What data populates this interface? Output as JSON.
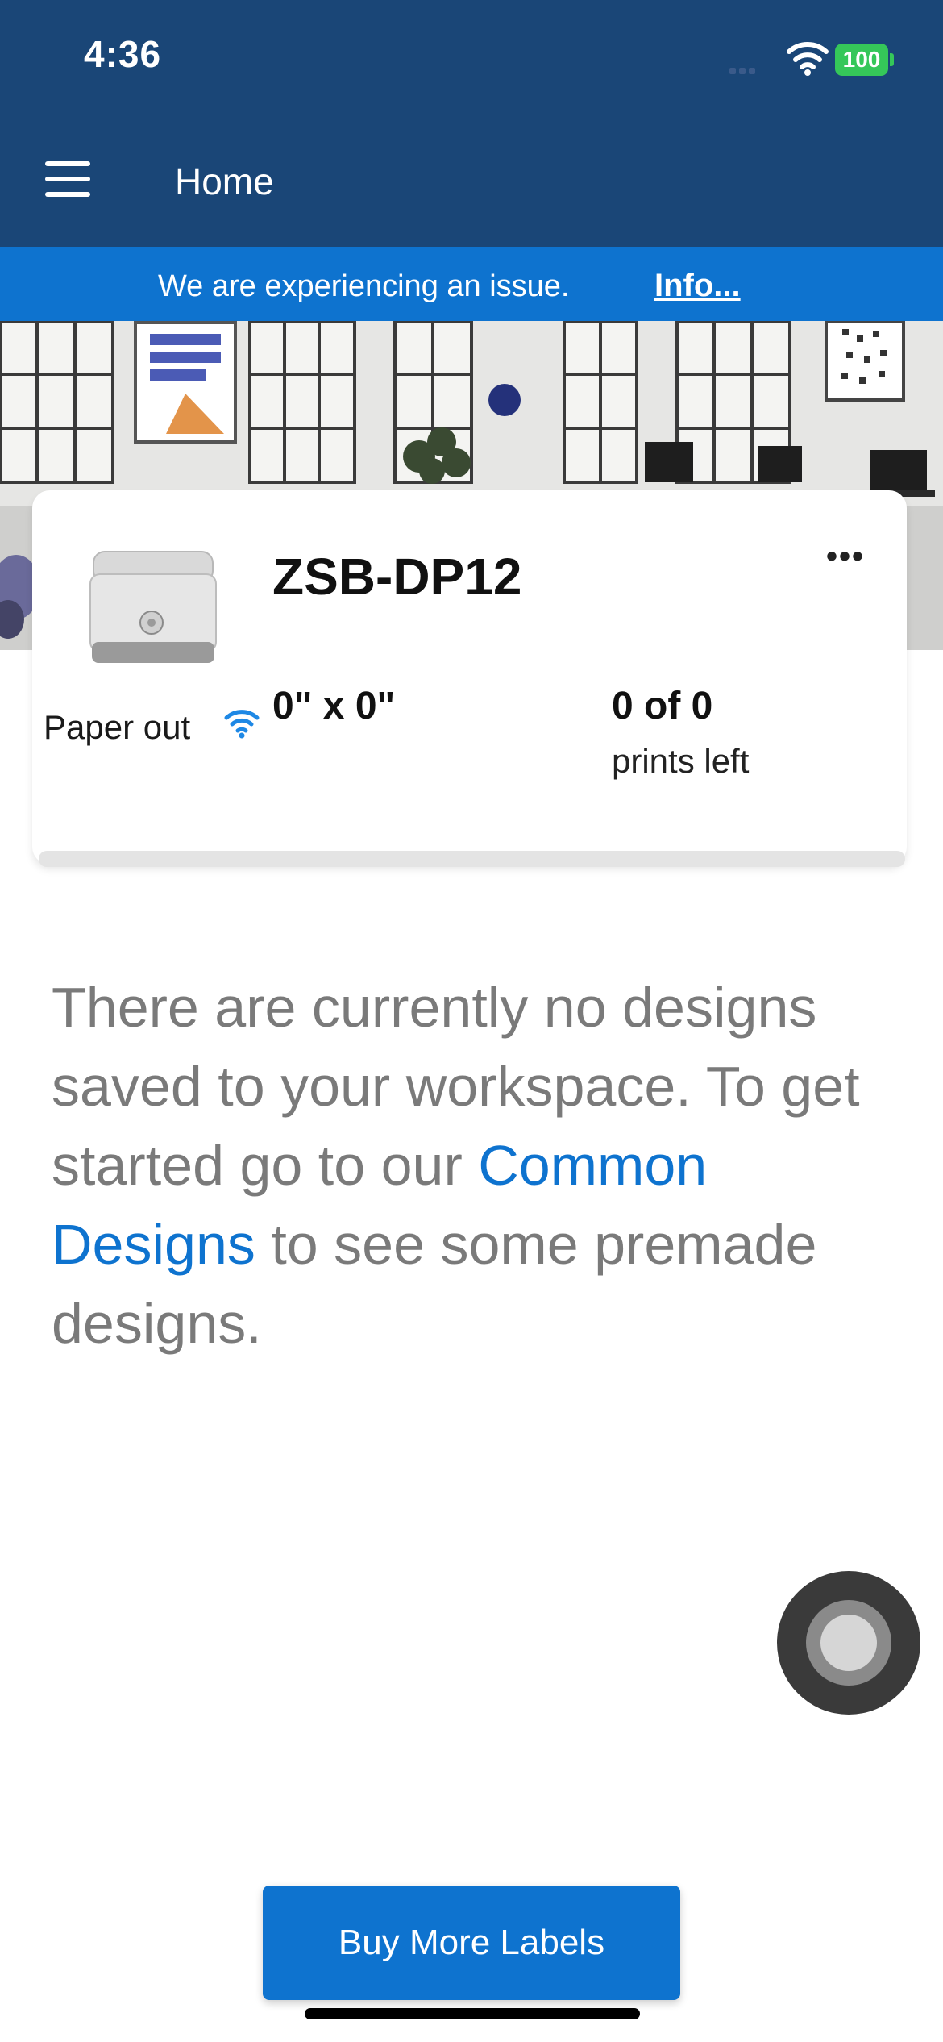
{
  "status_bar": {
    "time": "4:36",
    "battery": "100"
  },
  "header": {
    "title": "Home"
  },
  "banner": {
    "message": "We are experiencing an issue.",
    "link": "Info..."
  },
  "printer_card": {
    "name": "ZSB-DP12",
    "status": "Paper out",
    "label_size": "0\" x 0\"",
    "prints_count": "0 of 0",
    "prints_caption": "prints left"
  },
  "empty_state": {
    "text_before": "There are currently no designs saved to your workspace. To get started go to our ",
    "link": "Common Designs",
    "text_after": " to see some premade designs."
  },
  "actions": {
    "buy_labels": "Buy More Labels"
  },
  "colors": {
    "header_bg": "#1a4677",
    "banner_bg": "#0e73cf",
    "accent": "#0e73cf",
    "battery": "#35c759"
  }
}
